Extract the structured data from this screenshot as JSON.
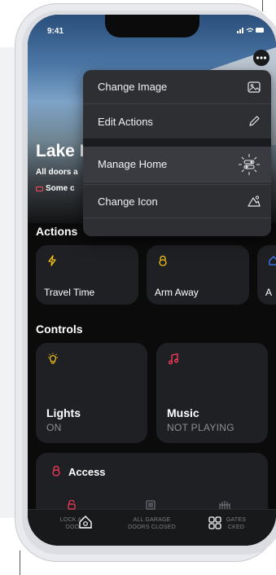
{
  "status_bar": {
    "time": "9:41",
    "icons": "..ll ≈ ▬"
  },
  "home": {
    "name": "Lake I",
    "subtitle": "All doors a",
    "alert": "Some c"
  },
  "menu": {
    "items": [
      {
        "label": "Change Image",
        "icon": "image-icon"
      },
      {
        "label": "Edit Actions",
        "icon": "pencil-icon"
      },
      {
        "label": "Manage Home",
        "icon": "sliders-icon"
      },
      {
        "label": "Change Icon",
        "icon": "home-shape-icon"
      }
    ]
  },
  "actions": {
    "title": "Actions",
    "items": [
      {
        "label": "Travel Time",
        "icon": "lightning-icon",
        "color": "#f5c518"
      },
      {
        "label": "Arm Away",
        "icon": "lock-icon",
        "color": "#f5c518"
      },
      {
        "label": "A",
        "icon": "home-icon",
        "color": "#3d7bff"
      }
    ]
  },
  "controls": {
    "title": "Controls",
    "items": [
      {
        "label": "Lights",
        "state": "ON",
        "icon": "bulb-icon",
        "color": "#f5c518"
      },
      {
        "label": "Music",
        "state": "NOT PLAYING",
        "icon": "music-note-icon",
        "color": "#ff3b5c"
      }
    ]
  },
  "access": {
    "title": "Access",
    "icon_color": "#ff3b5c"
  },
  "tabbar": {
    "tabs": [
      {
        "line1": "LOCK AL",
        "line2": "DOO"
      },
      {
        "line1": "ALL GARAGE",
        "line2": "DOORS CLOSED"
      },
      {
        "line1": "GATES",
        "line2": "CKED"
      }
    ]
  },
  "colors": {
    "accent_yellow": "#f5c518",
    "accent_red": "#ff3b5c",
    "accent_blue": "#3d7bff"
  }
}
